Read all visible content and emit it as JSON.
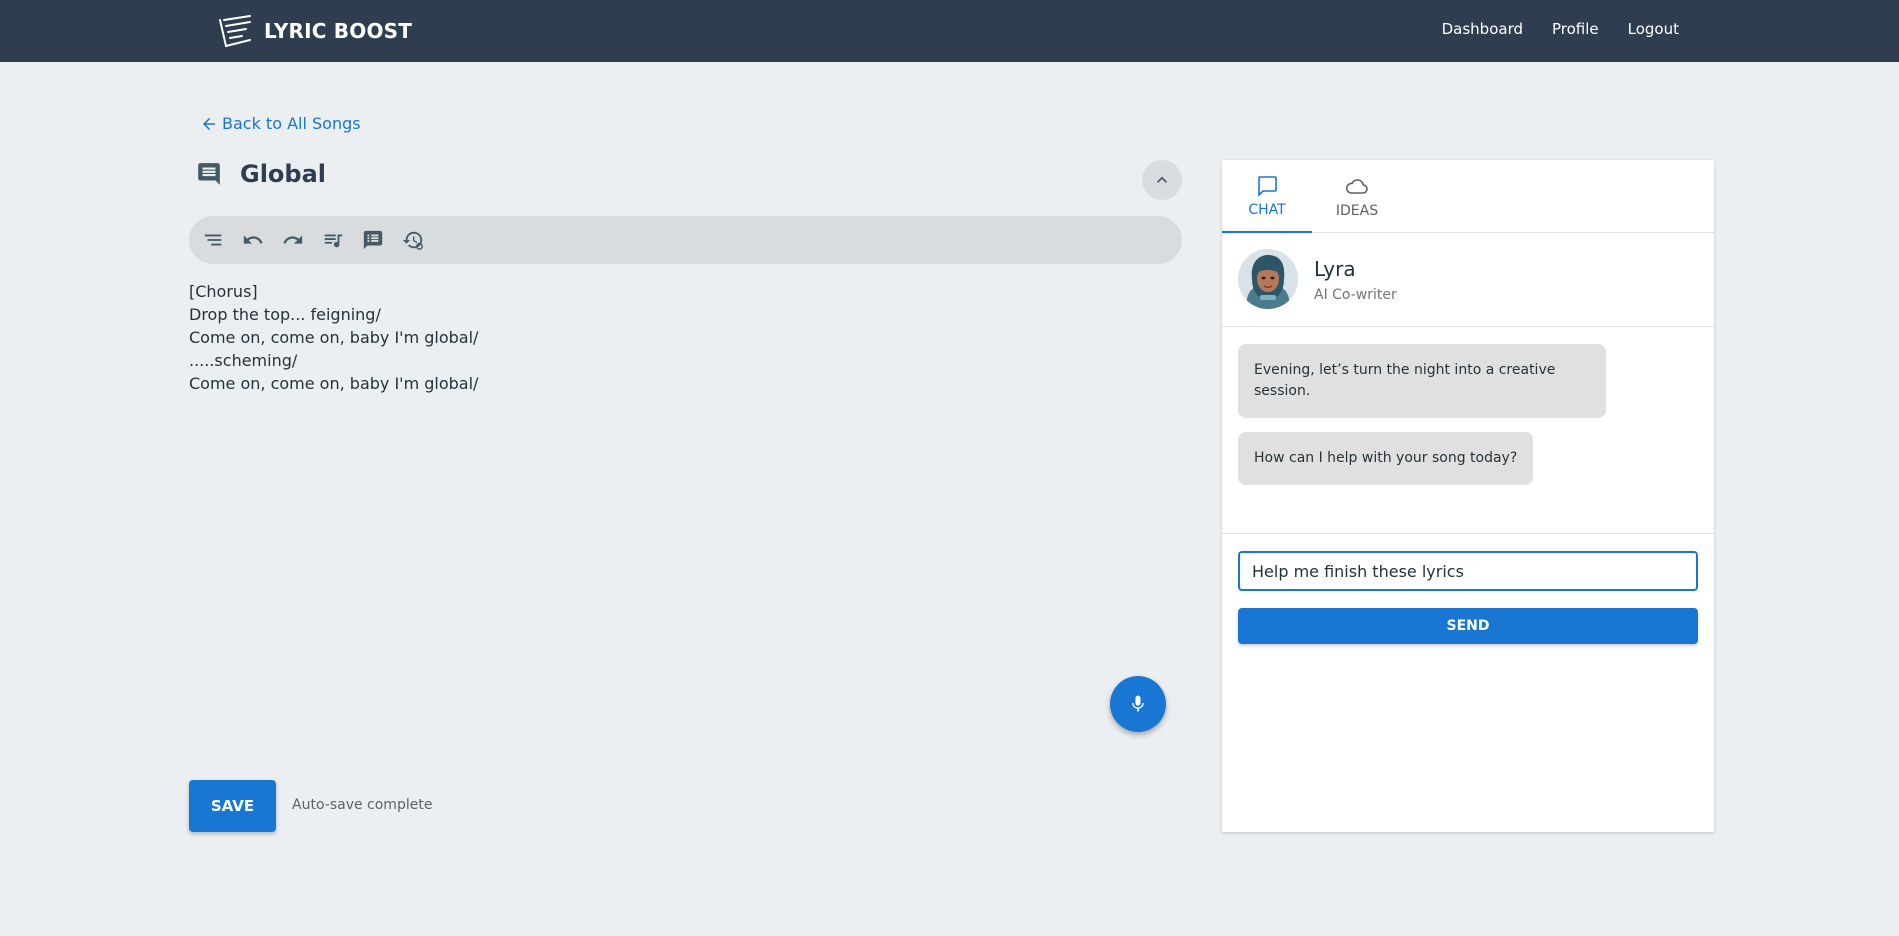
{
  "brand": {
    "name": "LYRIC BOOST",
    "logo_icon": "notebook-lines-icon"
  },
  "nav": {
    "items": [
      "Dashboard",
      "Profile",
      "Logout"
    ]
  },
  "back_link": {
    "label": "Back to All Songs",
    "icon": "arrow-left-icon"
  },
  "song": {
    "title": "Global",
    "lyrics": [
      "[Chorus]",
      "Drop the top... feigning/",
      "Come on, come on, baby I'm global/",
      ".....scheming/",
      "Come on, come on, baby I'm global/"
    ]
  },
  "toolbar": {
    "buttons": [
      "outline-icon",
      "undo-icon",
      "redo-icon",
      "playlist-music-icon",
      "comment-text-icon",
      "history-settings-icon"
    ]
  },
  "save": {
    "label": "SAVE",
    "status": "Auto-save complete"
  },
  "panel": {
    "tabs": [
      {
        "label": "CHAT",
        "icon": "chat-bubble-icon",
        "active": true
      },
      {
        "label": "IDEAS",
        "icon": "cloud-icon",
        "active": false
      }
    ],
    "agent": {
      "name": "Lyra",
      "role": "AI Co-writer"
    },
    "messages": [
      "Evening, let’s turn the night into a creative session.",
      "How can I help with your song today?"
    ],
    "input": {
      "value": "Help me finish these lyrics"
    },
    "send_label": "SEND"
  },
  "colors": {
    "nav_bg": "#2e3e50",
    "accent": "#1976d2",
    "page_bg": "#eceff1"
  }
}
